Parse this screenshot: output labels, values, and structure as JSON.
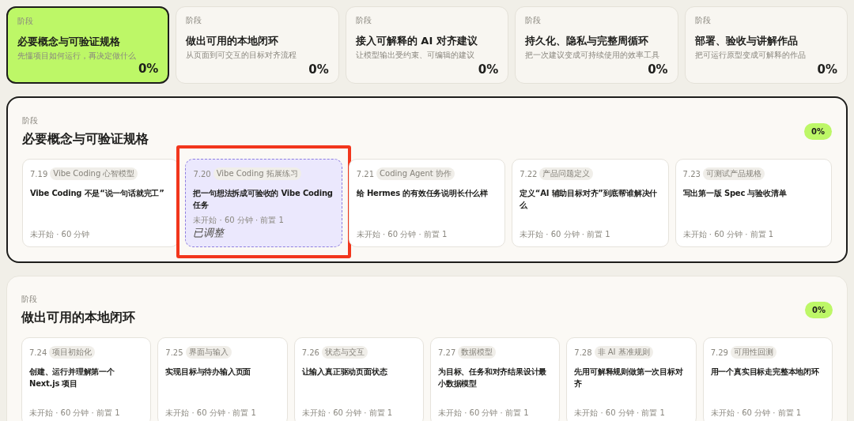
{
  "stages": [
    {
      "label": "阶段",
      "title": "必要概念与可验证规格",
      "subtitle": "先懂项目如何运行，再决定做什么",
      "percent": "0%",
      "selected": true
    },
    {
      "label": "阶段",
      "title": "做出可用的本地闭环",
      "subtitle": "从页面到可交互的目标对齐流程",
      "percent": "0%",
      "selected": false
    },
    {
      "label": "阶段",
      "title": "接入可解释的 AI 对齐建议",
      "subtitle": "让模型输出受约束、可编辑的建议",
      "percent": "0%",
      "selected": false
    },
    {
      "label": "阶段",
      "title": "持久化、隐私与完整周循环",
      "subtitle": "把一次建议变成可持续使用的效率工具",
      "percent": "0%",
      "selected": false
    },
    {
      "label": "阶段",
      "title": "部署、验收与讲解作品",
      "subtitle": "把可运行原型变成可解释的作品",
      "percent": "0%",
      "selected": false
    }
  ],
  "sections": [
    {
      "label": "阶段",
      "title": "必要概念与可验证规格",
      "percent": "0%",
      "selected": true,
      "lessons": [
        {
          "kind": "normal",
          "date": "7.19",
          "tag": "Vibe Coding 心智模型",
          "title": "Vibe Coding 不是“说一句话就完工”",
          "meta": "未开始 · 60 分钟",
          "highlighted": false
        },
        {
          "kind": "adjusted",
          "date": "7.20",
          "tag": "Vibe Coding 拓展练习",
          "title": "把一句想法拆成可验收的 Vibe Coding 任务",
          "meta": "未开始 · 60 分钟 · 前置 1",
          "note": "已调整",
          "highlighted": true
        },
        {
          "kind": "normal",
          "date": "7.21",
          "tag": "Coding Agent 协作",
          "title": "给 Hermes 的有效任务说明长什么样",
          "meta": "未开始 · 60 分钟 · 前置 1",
          "highlighted": false
        },
        {
          "kind": "normal",
          "date": "7.22",
          "tag": "产品问题定义",
          "title": "定义“AI 辅助目标对齐”到底帮谁解决什么",
          "meta": "未开始 · 60 分钟 · 前置 1",
          "highlighted": false
        },
        {
          "kind": "normal",
          "date": "7.23",
          "tag": "可测试产品规格",
          "title": "写出第一版 Spec 与验收清单",
          "meta": "未开始 · 60 分钟 · 前置 1",
          "highlighted": false
        }
      ]
    },
    {
      "label": "阶段",
      "title": "做出可用的本地闭环",
      "percent": "0%",
      "selected": false,
      "lessons": [
        {
          "kind": "normal",
          "date": "7.24",
          "tag": "项目初始化",
          "title": "创建、运行并理解第一个 Next.js 项目",
          "meta": "未开始 · 60 分钟 · 前置 1",
          "highlighted": false
        },
        {
          "kind": "normal",
          "date": "7.25",
          "tag": "界面与输入",
          "title": "实现目标与待办输入页面",
          "meta": "未开始 · 60 分钟 · 前置 1",
          "highlighted": false
        },
        {
          "kind": "normal",
          "date": "7.26",
          "tag": "状态与交互",
          "title": "让输入真正驱动页面状态",
          "meta": "未开始 · 60 分钟 · 前置 1",
          "highlighted": false
        },
        {
          "kind": "normal",
          "date": "7.27",
          "tag": "数据模型",
          "title": "为目标、任务和对齐结果设计最小数据模型",
          "meta": "未开始 · 60 分钟 · 前置 1",
          "highlighted": false
        },
        {
          "kind": "normal",
          "date": "7.28",
          "tag": "非 AI 基准规则",
          "title": "先用可解释规则做第一次目标对齐",
          "meta": "未开始 · 60 分钟 · 前置 1",
          "highlighted": false
        },
        {
          "kind": "normal",
          "date": "7.29",
          "tag": "可用性回测",
          "title": "用一个真实目标走完整本地闭环",
          "meta": "未开始 · 60 分钟 · 前置 1",
          "highlighted": false
        }
      ]
    }
  ]
}
